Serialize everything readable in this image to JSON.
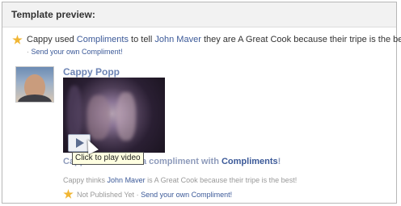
{
  "header": {
    "title": "Template preview:"
  },
  "story": {
    "text_1": "Cappy used",
    "app_link": "Compliments",
    "text_2": "to tell",
    "friend_link": "John Maver",
    "text_3": "they are A Great Cook because their tripe is the best!",
    "send_link": "Send your own Compliment!",
    "separator": "·"
  },
  "post": {
    "name": "Cappy Popp",
    "headline_prefix": "Capp",
    "headline_mid": "er a compliment with",
    "headline_link": "Compliments",
    "headline_suffix": "!",
    "tooltip": "Click to play video",
    "desc_1": "Cappy thinks",
    "desc_link": "John Maver",
    "desc_2": "is A Great Cook because their tripe is the best!",
    "footer_status": "Not Published Yet",
    "footer_sep": "·",
    "footer_link": "Send your own Compliment!"
  },
  "colors": {
    "link": "#3b5998",
    "name": "#6d84b4",
    "star": "#f1b634",
    "tooltip_bg": "#ffffe1"
  },
  "icons": {
    "star": "star-icon",
    "play": "play-icon",
    "cursor": "mouse-cursor-icon"
  }
}
